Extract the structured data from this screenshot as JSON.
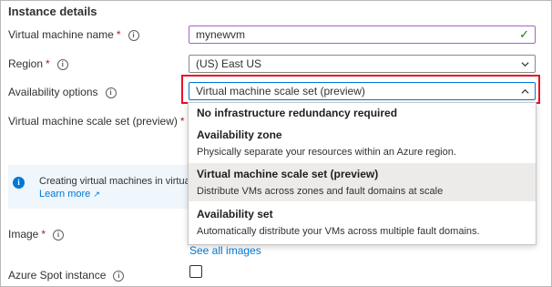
{
  "section": {
    "title": "Instance details"
  },
  "fields": {
    "vm_name": {
      "label": "Virtual machine name",
      "required_mark": "*",
      "value": "mynewvm"
    },
    "region": {
      "label": "Region",
      "required_mark": "*",
      "value": "(US) East US"
    },
    "availability": {
      "label": "Availability options",
      "value": "Virtual machine scale set (preview)"
    },
    "scale_set": {
      "label": "Virtual machine scale set (preview)",
      "required_mark": "*"
    },
    "image": {
      "label": "Image",
      "required_mark": "*",
      "link": "See all images"
    },
    "spot": {
      "label": "Azure Spot instance",
      "checked": false
    }
  },
  "info_banner": {
    "text": "Creating virtual machines in virtual mac",
    "link": "Learn more",
    "link_icon": "external-link-icon"
  },
  "dropdown": {
    "options": [
      {
        "title": "No infrastructure redundancy required",
        "description": ""
      },
      {
        "title": "Availability zone",
        "description": "Physically separate your resources within an Azure region."
      },
      {
        "title": "Virtual machine scale set (preview)",
        "description": "Distribute VMs across zones and fault domains at scale",
        "selected": true
      },
      {
        "title": "Availability set",
        "description": "Automatically distribute your VMs across multiple fault domains."
      }
    ]
  },
  "colors": {
    "accent": "#0078d4",
    "highlight_box": "#e81123",
    "valid_check": "#107c10",
    "required": "#a4262c"
  }
}
